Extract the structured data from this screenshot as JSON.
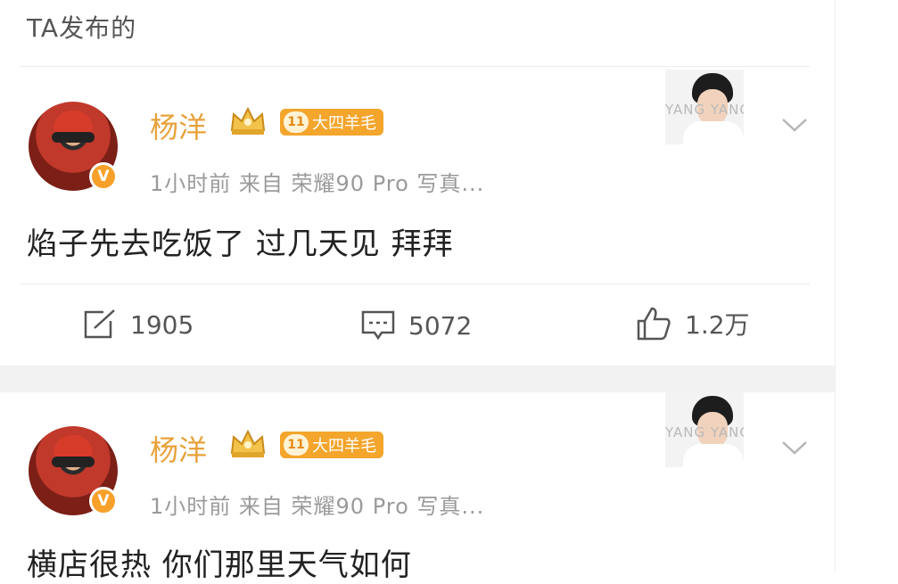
{
  "section_title": "TA发布的",
  "colors": {
    "username": "#e8a23a",
    "level_badge": "#f4a52c",
    "verified_badge": "#f7a12a",
    "meta": "#9a9a9a"
  },
  "posts": [
    {
      "author": "杨洋",
      "level_num": "11",
      "level_label": "大四羊毛",
      "verified": "V",
      "meta": "1小时前  来自 荣耀90 Pro 写真...",
      "content": "焰子先去吃饭了 过几天见 拜拜",
      "card_watermark": "YANG YANG",
      "actions": {
        "repost": "1905",
        "comment": "5072",
        "like": "1.2万"
      }
    },
    {
      "author": "杨洋",
      "level_num": "11",
      "level_label": "大四羊毛",
      "verified": "V",
      "meta": "1小时前  来自 荣耀90 Pro 写真...",
      "content": "横店很热 你们那里天气如何",
      "card_watermark": "YANG YANG"
    }
  ],
  "icons": [
    "crown-icon",
    "repost-icon",
    "comment-icon",
    "like-icon",
    "chevron-down-icon"
  ]
}
